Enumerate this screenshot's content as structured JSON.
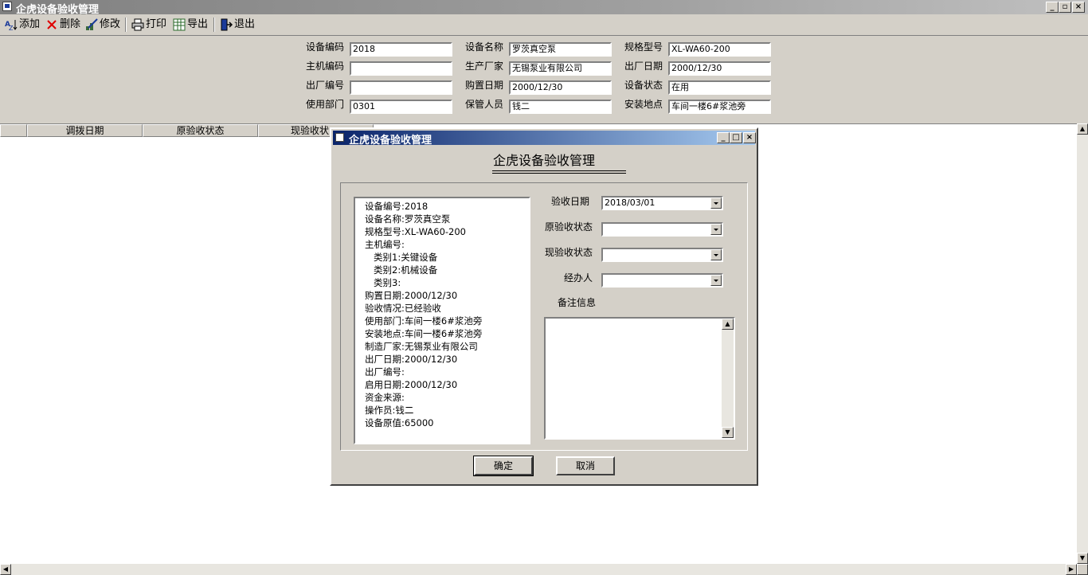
{
  "window": {
    "title": "企虎设备验收管理"
  },
  "toolbar": {
    "add": "添加",
    "delete": "删除",
    "edit": "修改",
    "print": "打印",
    "export": "导出",
    "exit": "退出"
  },
  "form": {
    "equip_code": {
      "label": "设备编码",
      "value": "2018"
    },
    "equip_name": {
      "label": "设备名称",
      "value": "罗茨真空泵"
    },
    "model": {
      "label": "规格型号",
      "value": "XL-WA60-200"
    },
    "host_code": {
      "label": "主机编码",
      "value": ""
    },
    "manufacturer": {
      "label": "生产厂家",
      "value": "无锡泵业有限公司"
    },
    "factory_date": {
      "label": "出厂日期",
      "value": "2000/12/30"
    },
    "factory_no": {
      "label": "出厂编号",
      "value": ""
    },
    "purchase_date": {
      "label": "购置日期",
      "value": "2000/12/30"
    },
    "status": {
      "label": "设备状态",
      "value": "在用"
    },
    "dept": {
      "label": "使用部门",
      "value": "0301"
    },
    "keeper": {
      "label": "保管人员",
      "value": "钱二"
    },
    "location": {
      "label": "安装地点",
      "value": "车间一楼6#浆池旁"
    }
  },
  "grid": {
    "columns": [
      "调拨日期",
      "原验收状态",
      "现验收状"
    ]
  },
  "dialog": {
    "title": "企虎设备验收管理",
    "heading": "企虎设备验收管理",
    "info": [
      "设备编号:2018",
      "设备名称:罗茨真空泵",
      "规格型号:XL-WA60-200",
      "主机编号:",
      "类别1:关键设备",
      "类别2:机械设备",
      "类别3:",
      "购置日期:2000/12/30",
      "验收情况:已经验收",
      "使用部门:车间一楼6#浆池旁",
      "安装地点:车间一楼6#浆池旁",
      "制造厂家:无锡泵业有限公司",
      "出厂日期:2000/12/30",
      "出厂编号:",
      "启用日期:2000/12/30",
      "资金来源:",
      "操作员:钱二",
      "设备原值:65000"
    ],
    "accept_date": {
      "label": "验收日期",
      "value": "2018/03/01"
    },
    "orig_status": {
      "label": "原验收状态",
      "value": ""
    },
    "curr_status": {
      "label": "现验收状态",
      "value": ""
    },
    "handler": {
      "label": "经办人",
      "value": ""
    },
    "memo_label": "备注信息",
    "ok": "确定",
    "cancel": "取消"
  }
}
